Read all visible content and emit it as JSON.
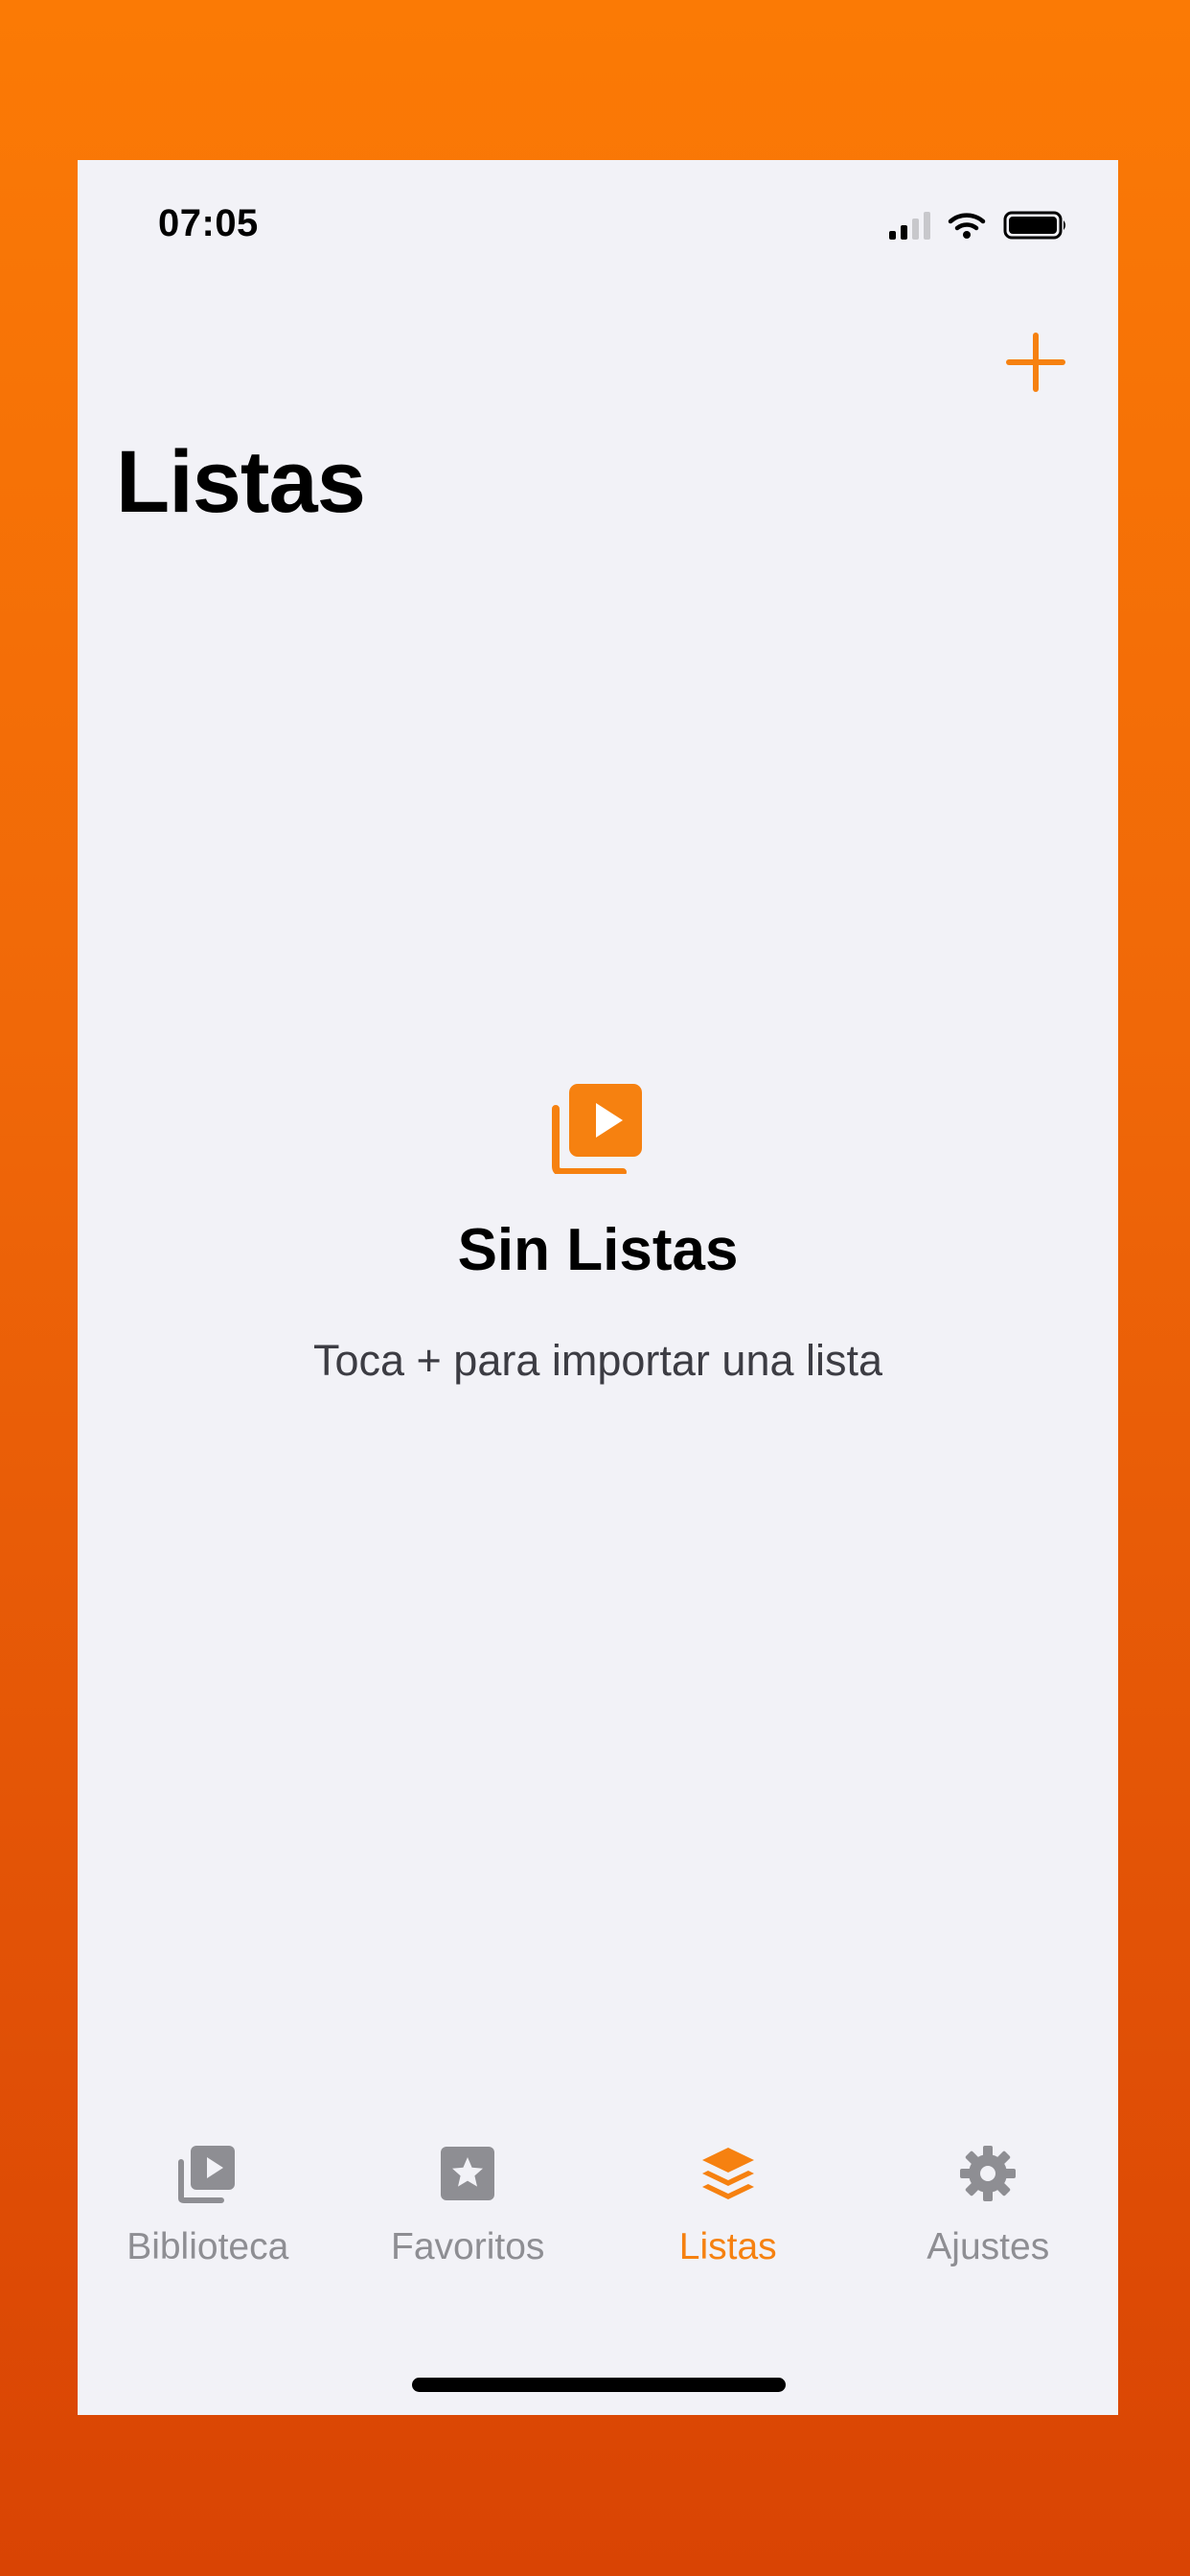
{
  "status_bar": {
    "time": "07:05"
  },
  "nav": {
    "title": "Listas",
    "add_icon": "plus-icon"
  },
  "empty_state": {
    "icon": "play-library-icon",
    "title": "Sin Listas",
    "subtitle": "Toca + para importar una lista"
  },
  "tab_bar": {
    "tabs": [
      {
        "label": "Biblioteca",
        "icon": "play-library-icon",
        "active": false
      },
      {
        "label": "Favoritos",
        "icon": "star-icon",
        "active": false
      },
      {
        "label": "Listas",
        "icon": "layers-icon",
        "active": true
      },
      {
        "label": "Ajustes",
        "icon": "gear-icon",
        "active": false
      }
    ]
  },
  "colors": {
    "accent": "#f68110",
    "inactive": "#8e8e93",
    "background": "#f2f2f7",
    "frame": "#f06808"
  }
}
